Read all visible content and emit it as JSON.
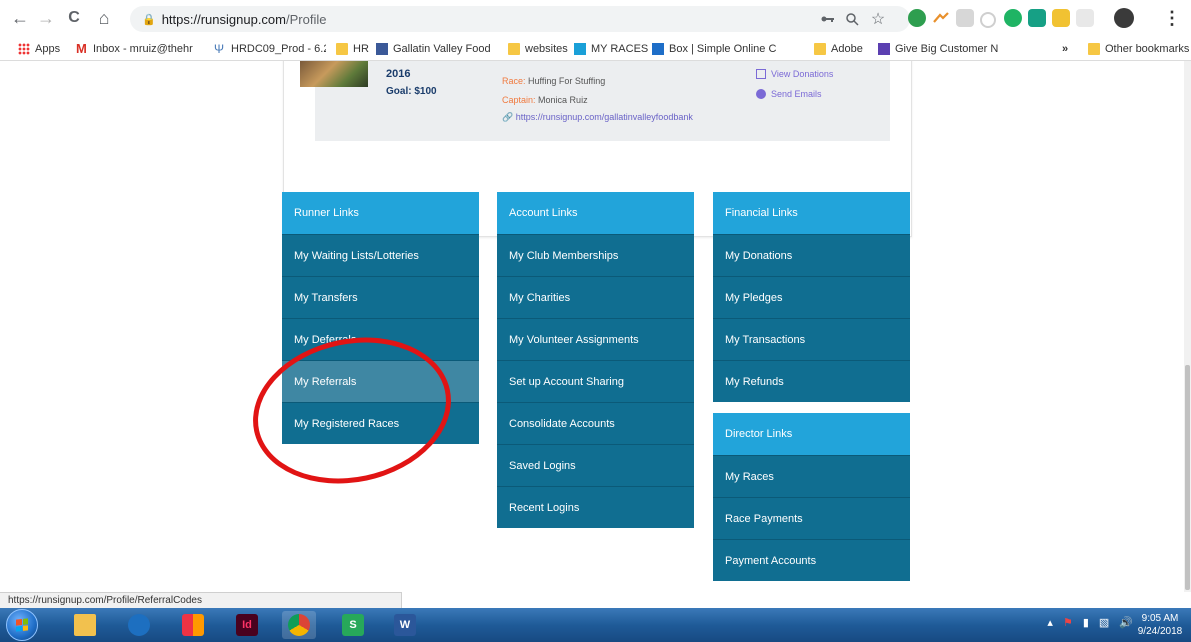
{
  "browser": {
    "url_host": "https://runsignup.com",
    "url_path": "/Profile",
    "back_icon": "←",
    "forward_icon": "→",
    "reload_icon": "C",
    "home_icon": "⌂",
    "star_icon": "☆",
    "menu_icon": "⋮"
  },
  "bookmarks": {
    "apps": "Apps",
    "items": [
      "Inbox - mruiz@thehr",
      "HRDC09_Prod - 6.2",
      "HR",
      "Gallatin Valley Food",
      "websites",
      "MY RACES",
      "Box | Simple Online C",
      "Adobe",
      "Give Big Customer N"
    ],
    "overflow": "»",
    "other": "Other bookmarks"
  },
  "team": {
    "year": "2016",
    "goal": "Goal: $100",
    "race_label": "Race:",
    "race": "Huffing For Stuffing",
    "captain_label": "Captain:",
    "captain": "Monica Ruiz",
    "link": "https://runsignup.com/gallatinvalleyfoodbank",
    "view_donations": "View Donations",
    "send_emails": "Send Emails"
  },
  "runner_links": {
    "title": "Runner Links",
    "items": [
      "My Waiting Lists/Lotteries",
      "My Transfers",
      "My Deferrals",
      "My Referrals",
      "My Registered Races"
    ]
  },
  "account_links": {
    "title": "Account Links",
    "items": [
      "My Club Memberships",
      "My Charities",
      "My Volunteer Assignments",
      "Set up Account Sharing",
      "Consolidate Accounts",
      "Saved Logins",
      "Recent Logins"
    ]
  },
  "financial_links": {
    "title": "Financial Links",
    "items": [
      "My Donations",
      "My Pledges",
      "My Transactions",
      "My Refunds"
    ]
  },
  "director_links": {
    "title": "Director Links",
    "items": [
      "My Races",
      "Race Payments",
      "Payment Accounts"
    ]
  },
  "status_url": "https://runsignup.com/Profile/ReferralCodes",
  "taskbar": {
    "time": "9:05 AM",
    "date": "9/24/2018",
    "indesign_label": "Id",
    "sheets_label": "S",
    "word_label": "W"
  },
  "colors": {
    "menu_head": "#22a4da",
    "menu_item": "#106e91",
    "menu_hover": "#3f87a3",
    "annotation": "#e11414"
  }
}
